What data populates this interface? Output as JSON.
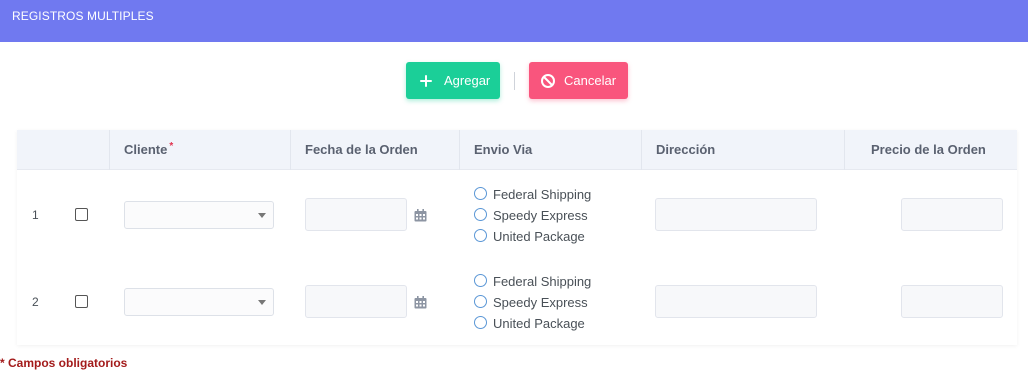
{
  "header": {
    "title": "REGISTROS MULTIPLES"
  },
  "toolbar": {
    "add_label": "Agregar",
    "cancel_label": "Cancelar"
  },
  "table": {
    "columns": {
      "cliente": "Cliente",
      "cliente_required": "*",
      "fecha": "Fecha de la Orden",
      "envio": "Envio Via",
      "direccion": "Dirección",
      "precio": "Precio de la Orden"
    },
    "rows": [
      {
        "num": "1",
        "shipping": [
          "Federal Shipping",
          "Speedy Express",
          "United Package"
        ]
      },
      {
        "num": "2",
        "shipping": [
          "Federal Shipping",
          "Speedy Express",
          "United Package"
        ]
      }
    ]
  },
  "footnote": "* Campos obligatorios",
  "colors": {
    "header": "#7079f0",
    "add": "#1bcf98",
    "cancel": "#f9557d",
    "required": "#a31b1b"
  }
}
